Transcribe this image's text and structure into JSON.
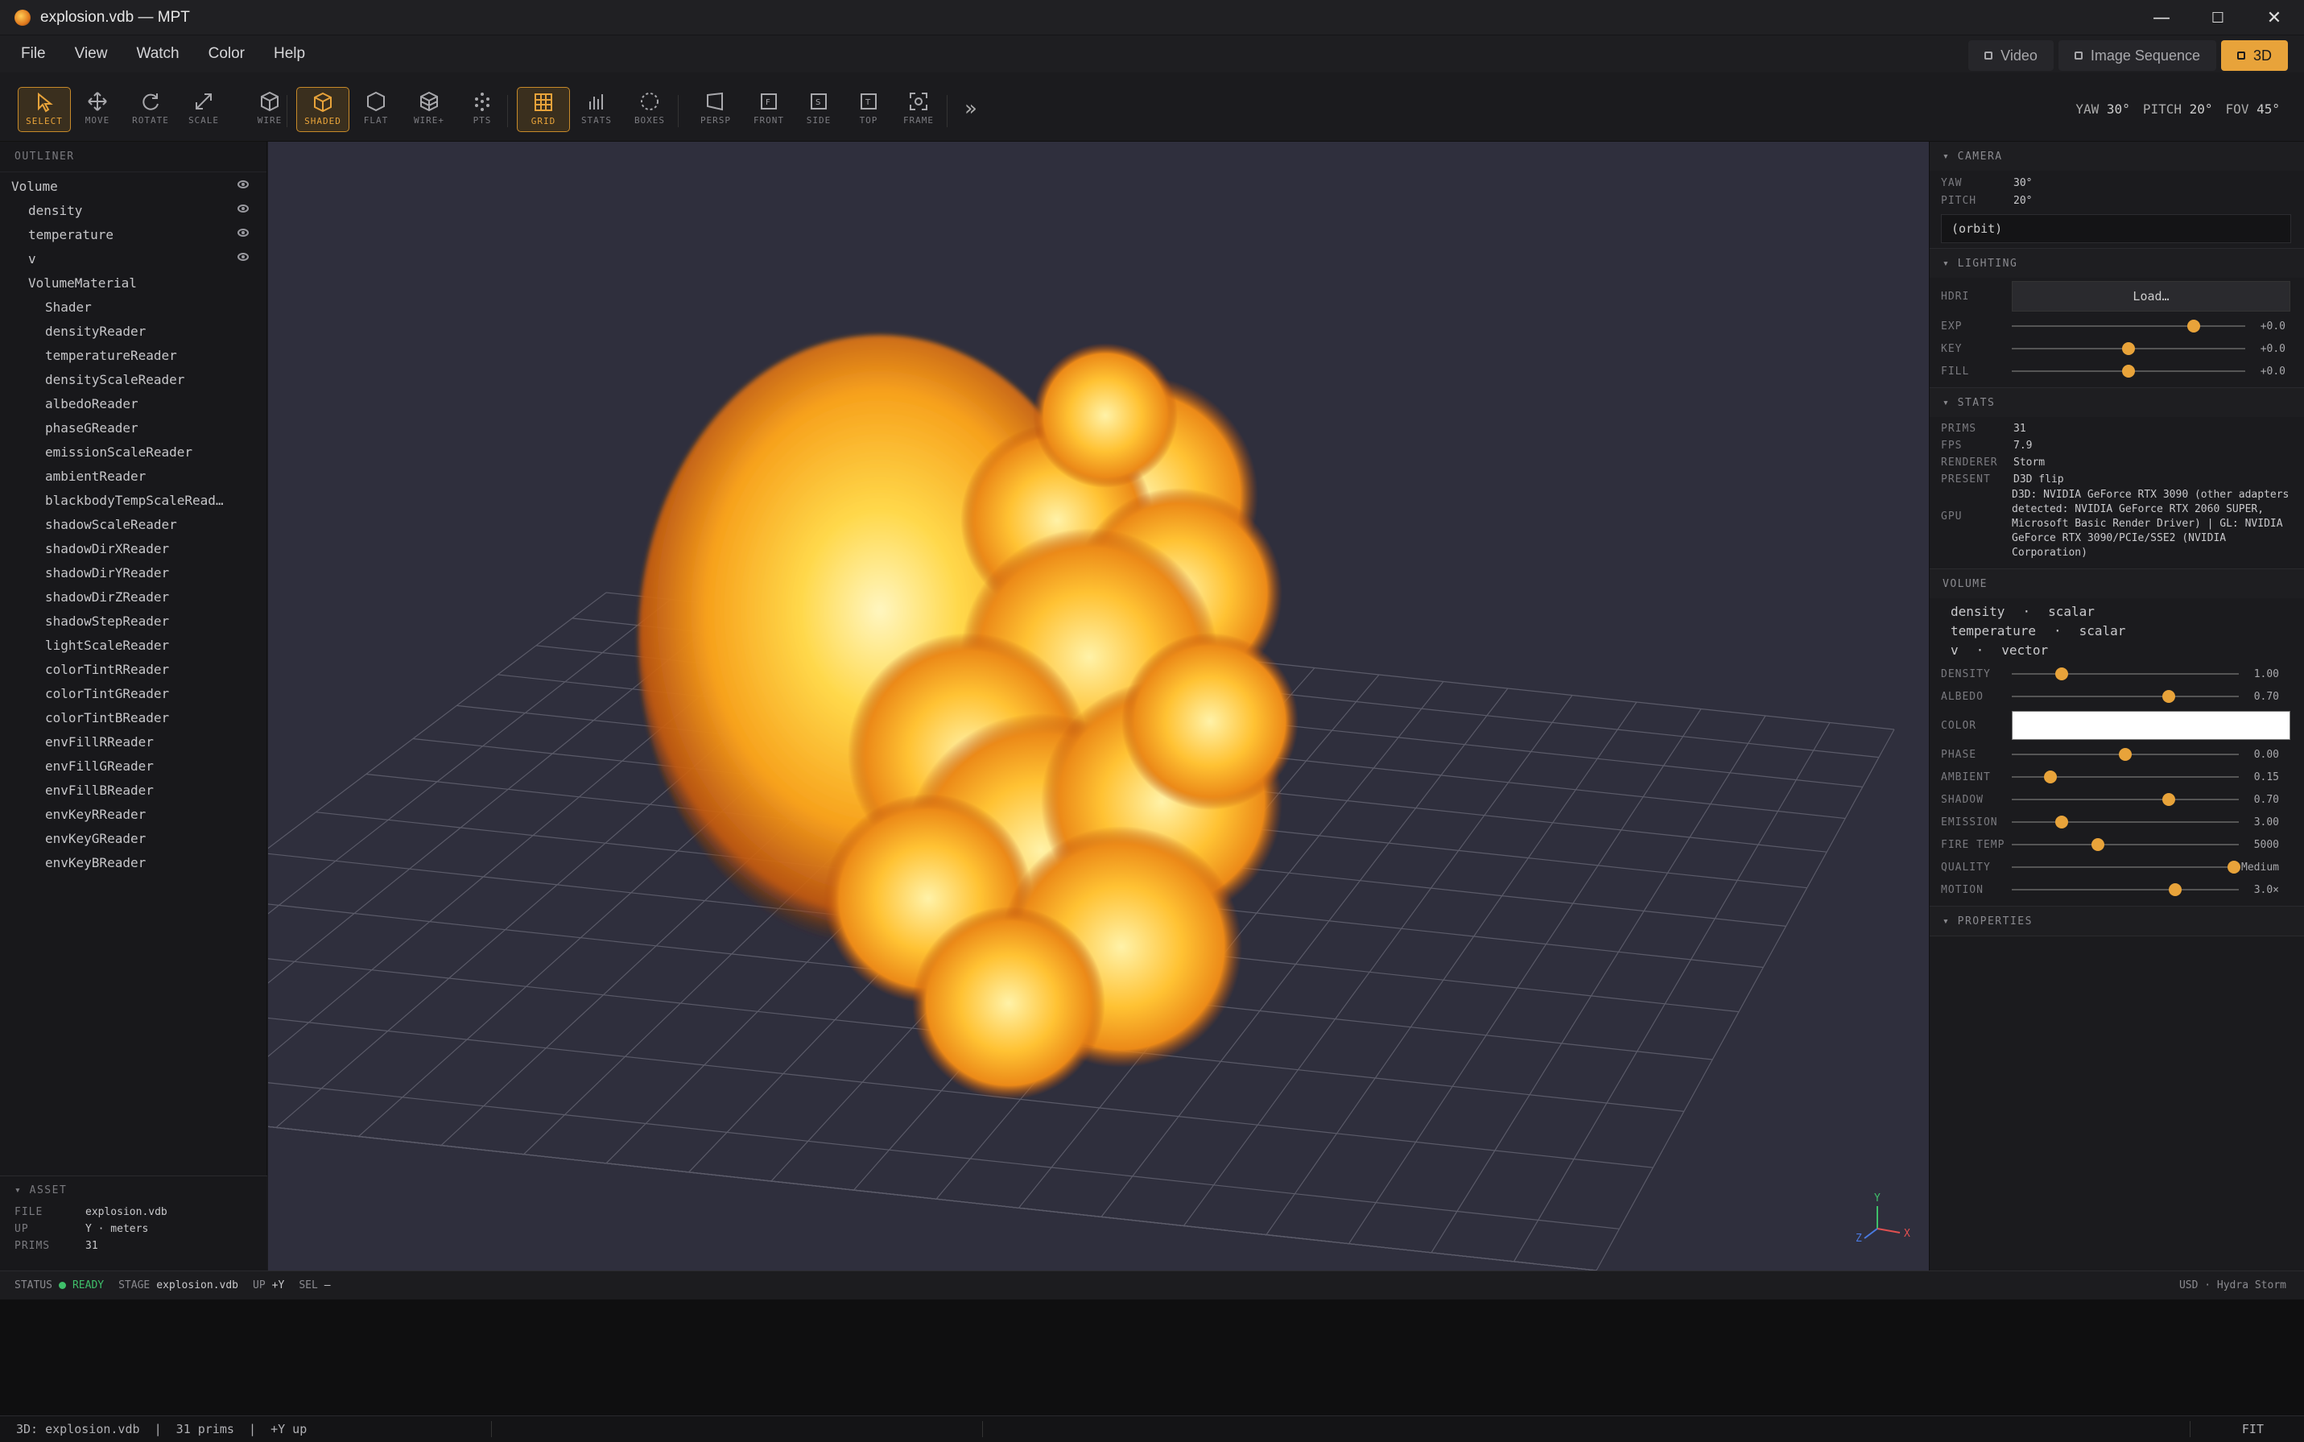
{
  "window": {
    "title": "explosion.vdb — MPT",
    "minimize": "—",
    "maximize": "☐",
    "close": "✕"
  },
  "menu": [
    "File",
    "View",
    "Watch",
    "Color",
    "Help"
  ],
  "modes": [
    {
      "label": "Video"
    },
    {
      "label": "Image Sequence"
    },
    {
      "label": "3D"
    }
  ],
  "toolbar": {
    "tools": [
      {
        "label": "SELECT",
        "icon": "cursor-icon"
      },
      {
        "label": "MOVE",
        "icon": "move-icon"
      },
      {
        "label": "ROTATE",
        "icon": "rotate-icon"
      },
      {
        "label": "SCALE",
        "icon": "scale-icon"
      },
      {
        "label": "WIRE",
        "icon": "wire-cube-icon"
      },
      {
        "label": "SHADED",
        "icon": "shaded-cube-icon"
      },
      {
        "label": "FLAT",
        "icon": "flat-hex-icon"
      },
      {
        "label": "WIRE+",
        "icon": "wire-plus-icon"
      },
      {
        "label": "PTS",
        "icon": "points-icon"
      },
      {
        "label": "GRID",
        "icon": "grid-icon"
      },
      {
        "label": "STATS",
        "icon": "stats-icon"
      },
      {
        "label": "BOXES",
        "icon": "boxes-icon"
      },
      {
        "label": "PERSP",
        "icon": "persp-icon"
      },
      {
        "label": "FRONT",
        "icon": "front-icon"
      },
      {
        "label": "SIDE",
        "icon": "side-icon"
      },
      {
        "label": "TOP",
        "icon": "top-icon"
      },
      {
        "label": "FRAME",
        "icon": "frame-icon"
      }
    ],
    "more": "»",
    "readout": {
      "yaw_label": "YAW",
      "yaw": "30°",
      "pitch_label": "PITCH",
      "pitch": "20°",
      "fov_label": "FOV",
      "fov": "45°"
    }
  },
  "outliner": {
    "title": "OUTLINER",
    "items": [
      {
        "label": "Volume",
        "level": 0,
        "eye": true
      },
      {
        "label": "density",
        "level": 1,
        "eye": true
      },
      {
        "label": "temperature",
        "level": 1,
        "eye": true
      },
      {
        "label": "v",
        "level": 1,
        "eye": true
      },
      {
        "label": "VolumeMaterial",
        "level": 1,
        "eye": false
      },
      {
        "label": "Shader",
        "level": 2,
        "eye": false
      },
      {
        "label": "densityReader",
        "level": 2,
        "eye": false
      },
      {
        "label": "temperatureReader",
        "level": 2,
        "eye": false
      },
      {
        "label": "densityScaleReader",
        "level": 2,
        "eye": false
      },
      {
        "label": "albedoReader",
        "level": 2,
        "eye": false
      },
      {
        "label": "phaseGReader",
        "level": 2,
        "eye": false
      },
      {
        "label": "emissionScaleReader",
        "level": 2,
        "eye": false
      },
      {
        "label": "ambientReader",
        "level": 2,
        "eye": false
      },
      {
        "label": "blackbodyTempScaleRead…",
        "level": 2,
        "eye": false
      },
      {
        "label": "shadowScaleReader",
        "level": 2,
        "eye": false
      },
      {
        "label": "shadowDirXReader",
        "level": 2,
        "eye": false
      },
      {
        "label": "shadowDirYReader",
        "level": 2,
        "eye": false
      },
      {
        "label": "shadowDirZReader",
        "level": 2,
        "eye": false
      },
      {
        "label": "shadowStepReader",
        "level": 2,
        "eye": false
      },
      {
        "label": "lightScaleReader",
        "level": 2,
        "eye": false
      },
      {
        "label": "colorTintRReader",
        "level": 2,
        "eye": false
      },
      {
        "label": "colorTintGReader",
        "level": 2,
        "eye": false
      },
      {
        "label": "colorTintBReader",
        "level": 2,
        "eye": false
      },
      {
        "label": "envFillRReader",
        "level": 2,
        "eye": false
      },
      {
        "label": "envFillGReader",
        "level": 2,
        "eye": false
      },
      {
        "label": "envFillBReader",
        "level": 2,
        "eye": false
      },
      {
        "label": "envKeyRReader",
        "level": 2,
        "eye": false
      },
      {
        "label": "envKeyGReader",
        "level": 2,
        "eye": false
      },
      {
        "label": "envKeyBReader",
        "level": 2,
        "eye": false
      }
    ]
  },
  "asset": {
    "title": "▾ ASSET",
    "file_label": "FILE",
    "file": "explosion.vdb",
    "up_label": "UP",
    "up": "Y · meters",
    "prims_label": "PRIMS",
    "prims": "31"
  },
  "viewport": {
    "axis_x": "X",
    "axis_y": "Y",
    "axis_z": "Z"
  },
  "camera": {
    "title": "▾ CAMERA",
    "yaw_label": "YAW",
    "yaw": "30°",
    "pitch_label": "PITCH",
    "pitch": "20°",
    "mode": "(orbit)"
  },
  "lighting": {
    "title": "▾ LIGHTING",
    "hdri_label": "HDRI",
    "load": "Load…",
    "sliders": [
      {
        "label": "EXP",
        "value": "+0.0",
        "pos": 0.78
      },
      {
        "label": "KEY",
        "value": "+0.0",
        "pos": 0.5
      },
      {
        "label": "FILL",
        "value": "+0.0",
        "pos": 0.5
      }
    ]
  },
  "stats": {
    "title": "▾ STATS",
    "rows": [
      {
        "k": "PRIMS",
        "v": "31"
      },
      {
        "k": "FPS",
        "v": "7.9"
      },
      {
        "k": "RENDERER",
        "v": "Storm"
      },
      {
        "k": "PRESENT",
        "v": "D3D flip"
      }
    ],
    "gpu_label": "GPU",
    "gpu": "D3D: NVIDIA GeForce RTX 3090 (other adapters detected: NVIDIA GeForce RTX 2060 SUPER, Microsoft Basic Render Driver) | GL: NVIDIA GeForce RTX 3090/PCIe/SSE2 (NVIDIA Corporation)"
  },
  "volume": {
    "title": "VOLUME",
    "fields": [
      {
        "name": "density",
        "type": "scalar"
      },
      {
        "name": "temperature",
        "type": "scalar"
      },
      {
        "name": "v",
        "type": "vector"
      }
    ],
    "sep": "·",
    "sliders": [
      {
        "label": "DENSITY",
        "value": "1.00",
        "pos": 0.22
      },
      {
        "label": "ALBEDO",
        "value": "0.70",
        "pos": 0.69
      },
      {
        "label": "PHASE",
        "value": "0.00",
        "pos": 0.5
      },
      {
        "label": "AMBIENT",
        "value": "0.15",
        "pos": 0.17
      },
      {
        "label": "SHADOW",
        "value": "0.70",
        "pos": 0.69
      },
      {
        "label": "EMISSION",
        "value": "3.00",
        "pos": 0.22
      },
      {
        "label": "FIRE TEMP",
        "value": "5000",
        "pos": 0.38
      },
      {
        "label": "QUALITY",
        "value": "Medium",
        "pos": 0.98
      },
      {
        "label": "MOTION",
        "value": "3.0×",
        "pos": 0.72
      }
    ],
    "color_label": "COLOR",
    "color": "#ffffff"
  },
  "properties": {
    "title": "▾ PROPERTIES"
  },
  "status": {
    "status_label": "STATUS",
    "status": "READY",
    "stage_label": "STAGE",
    "stage": "explosion.vdb",
    "up_label": "UP",
    "up": "+Y",
    "sel_label": "SEL",
    "sel": "—",
    "right": "USD · Hydra Storm"
  },
  "footer": {
    "left": "3D: explosion.vdb  |  31 prims  |  +Y up",
    "right": "FIT"
  },
  "colors": {
    "accent": "#e8a33a",
    "ready": "#3fbf6a"
  }
}
